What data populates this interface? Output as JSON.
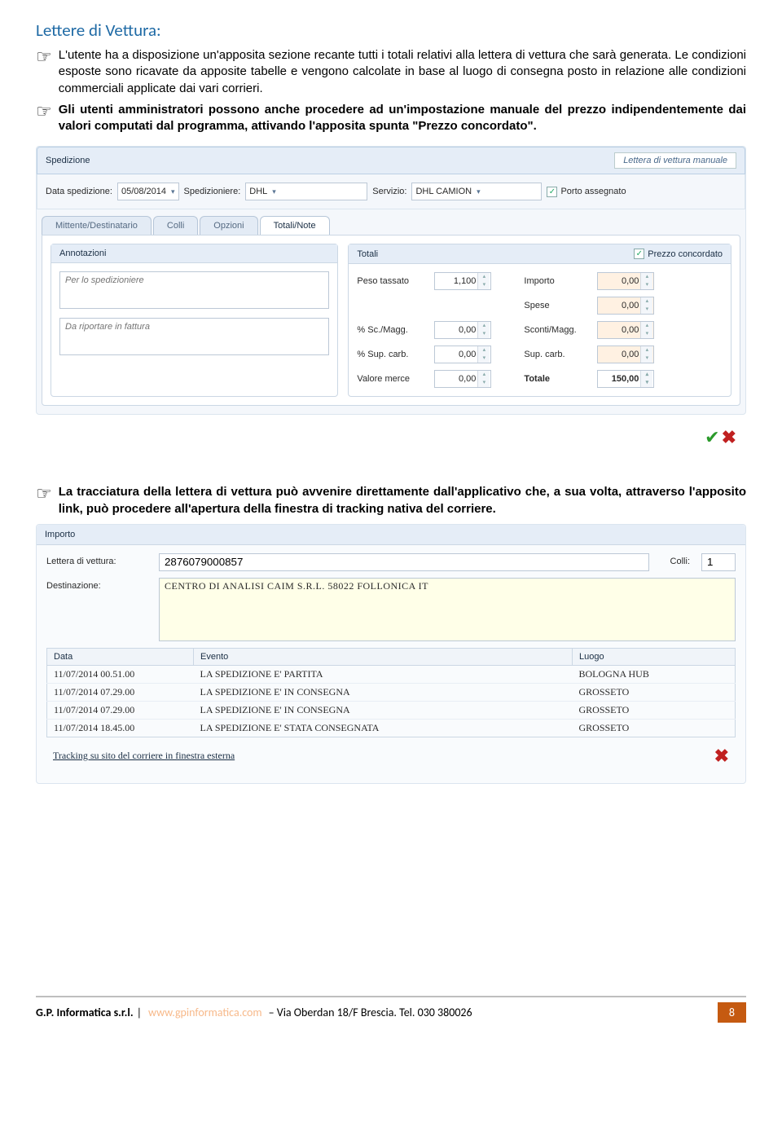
{
  "section_title": "Lettere di Vettura:",
  "bullets": [
    "L'utente ha a disposizione un'apposita sezione recante tutti i totali relativi alla lettera di vettura che sarà generata. Le condizioni esposte sono ricavate da apposite tabelle e vengono calcolate in base al luogo di consegna posto in relazione alle condizioni commerciali applicate dai vari corrieri.",
    "Gli utenti amministratori possono anche procedere ad un'impostazione manuale del prezzo indipendentemente dai valori computati dal programma, attivando l'apposita spunta \"Prezzo concordato\"."
  ],
  "s1": {
    "panel_title": "Spedizione",
    "manual_btn": "Lettera di vettura manuale",
    "fields": {
      "data_sped_lbl": "Data spedizione:",
      "data_sped_val": "05/08/2014",
      "spedizioniere_lbl": "Spedizioniere:",
      "spedizioniere_val": "DHL",
      "servizio_lbl": "Servizio:",
      "servizio_val": "DHL CAMION",
      "porto_lbl": "Porto assegnato"
    },
    "tabs": [
      "Mittente/Destinatario",
      "Colli",
      "Opzioni",
      "Totali/Note"
    ],
    "active_tab": 3,
    "annot": {
      "title": "Annotazioni",
      "ph1": "Per lo spedizioniere",
      "ph2": "Da riportare in fattura"
    },
    "tot": {
      "title": "Totali",
      "prezzo_conc": "Prezzo concordato",
      "rows": [
        {
          "l": "Peso tassato",
          "v": "1,100",
          "r": "Importo",
          "rv": "0,00"
        },
        {
          "l": "",
          "v": "",
          "r": "Spese",
          "rv": "0,00"
        },
        {
          "l": "% Sc./Magg.",
          "v": "0,00",
          "r": "Sconti/Magg.",
          "rv": "0,00"
        },
        {
          "l": "% Sup. carb.",
          "v": "0,00",
          "r": "Sup. carb.",
          "rv": "0,00"
        },
        {
          "l": "Valore merce",
          "v": "0,00",
          "r": "Totale",
          "rv": "150,00"
        }
      ]
    }
  },
  "bullet2": "La tracciatura della lettera di vettura può avvenire direttamente dall'applicativo che, a sua volta, attraverso l'apposito link, può procedere all'apertura della finestra di tracking nativa del corriere.",
  "s2": {
    "title": "Importo",
    "ldv_lbl": "Lettera di vettura:",
    "ldv_val": "2876079000857",
    "colli_lbl": "Colli:",
    "colli_val": "1",
    "dest_lbl": "Destinazione:",
    "dest_val": "CENTRO DI ANALISI CAIM S.R.L. 58022 FOLLONICA IT",
    "cols": [
      "Data",
      "Evento",
      "Luogo"
    ],
    "rows": [
      [
        "11/07/2014 00.51.00",
        "LA SPEDIZIONE E' PARTITA",
        "BOLOGNA HUB"
      ],
      [
        "11/07/2014 07.29.00",
        "LA SPEDIZIONE E' IN CONSEGNA",
        "GROSSETO"
      ],
      [
        "11/07/2014 07.29.00",
        "LA SPEDIZIONE E' IN CONSEGNA",
        "GROSSETO"
      ],
      [
        "11/07/2014 18.45.00",
        "LA SPEDIZIONE E' STATA CONSEGNATA",
        "GROSSETO"
      ]
    ],
    "link": "Tracking su sito del corriere in finestra esterna"
  },
  "footer": {
    "gp": "G.P. Informatica s.r.l.",
    "sep": "|",
    "url": "www.gpinformatica.com",
    "rest": "– Via Oberdan 18/F Brescia. Tel. 030 380026",
    "page": "8"
  }
}
